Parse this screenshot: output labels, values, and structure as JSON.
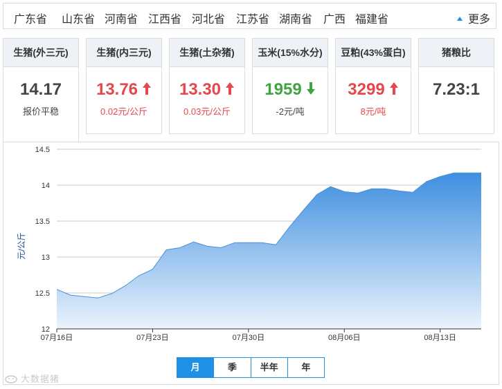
{
  "regions": [
    "广东省",
    "山东省",
    "河南省",
    "江西省",
    "河北省",
    "江苏省",
    "湖南省",
    "广西",
    "福建省"
  ],
  "more_label": "更多",
  "colors": {
    "accent": "#1e90e6",
    "up": "#e6474a",
    "down": "#3fa33f",
    "area_top": "#3f8fe0",
    "area_bottom": "#eaf3fc"
  },
  "cards": [
    {
      "title": "生猪(外三元)",
      "price": "14.17",
      "change": "报价平稳",
      "trend": "flat"
    },
    {
      "title": "生猪(内三元)",
      "price": "13.76",
      "change": "0.02元/公斤",
      "trend": "up"
    },
    {
      "title": "生猪(土杂猪)",
      "price": "13.30",
      "change": "0.03元/公斤",
      "trend": "up"
    },
    {
      "title": "玉米(15%水分)",
      "price": "1959",
      "change": "-2元/吨",
      "trend": "down"
    },
    {
      "title": "豆粕(43%蛋白)",
      "price": "3299",
      "change": "8元/吨",
      "trend": "up"
    },
    {
      "title": "猪粮比",
      "price": "7.23:1",
      "change": "",
      "trend": "none"
    }
  ],
  "chart_data": {
    "type": "area",
    "ylabel": "元/公斤",
    "ylim": [
      12,
      14.5
    ],
    "yticks": [
      12,
      12.5,
      13,
      13.5,
      14,
      14.5
    ],
    "x_ticks": [
      {
        "label": "07月16日",
        "index": 0
      },
      {
        "label": "07月23日",
        "index": 7
      },
      {
        "label": "07月30日",
        "index": 14
      },
      {
        "label": "08月06日",
        "index": 21
      },
      {
        "label": "08月13日",
        "index": 28
      }
    ],
    "x": [
      "07-16",
      "07-17",
      "07-18",
      "07-19",
      "07-20",
      "07-21",
      "07-22",
      "07-23",
      "07-24",
      "07-25",
      "07-26",
      "07-27",
      "07-28",
      "07-29",
      "07-30",
      "07-31",
      "08-01",
      "08-02",
      "08-03",
      "08-04",
      "08-05",
      "08-06",
      "08-07",
      "08-08",
      "08-09",
      "08-10",
      "08-11",
      "08-12",
      "08-13",
      "08-14",
      "08-15",
      "08-16"
    ],
    "values": [
      12.55,
      12.47,
      12.45,
      12.43,
      12.49,
      12.6,
      12.74,
      12.83,
      13.1,
      13.13,
      13.21,
      13.15,
      13.13,
      13.2,
      13.2,
      13.2,
      13.17,
      13.42,
      13.65,
      13.87,
      13.98,
      13.91,
      13.89,
      13.95,
      13.95,
      13.92,
      13.9,
      14.05,
      14.12,
      14.17,
      14.17,
      14.17
    ],
    "grid": true,
    "legend": "none"
  },
  "range_tabs": [
    {
      "label": "月",
      "active": true
    },
    {
      "label": "季",
      "active": false
    },
    {
      "label": "半年",
      "active": false
    },
    {
      "label": "年",
      "active": false
    }
  ],
  "watermark": "大数据猪"
}
